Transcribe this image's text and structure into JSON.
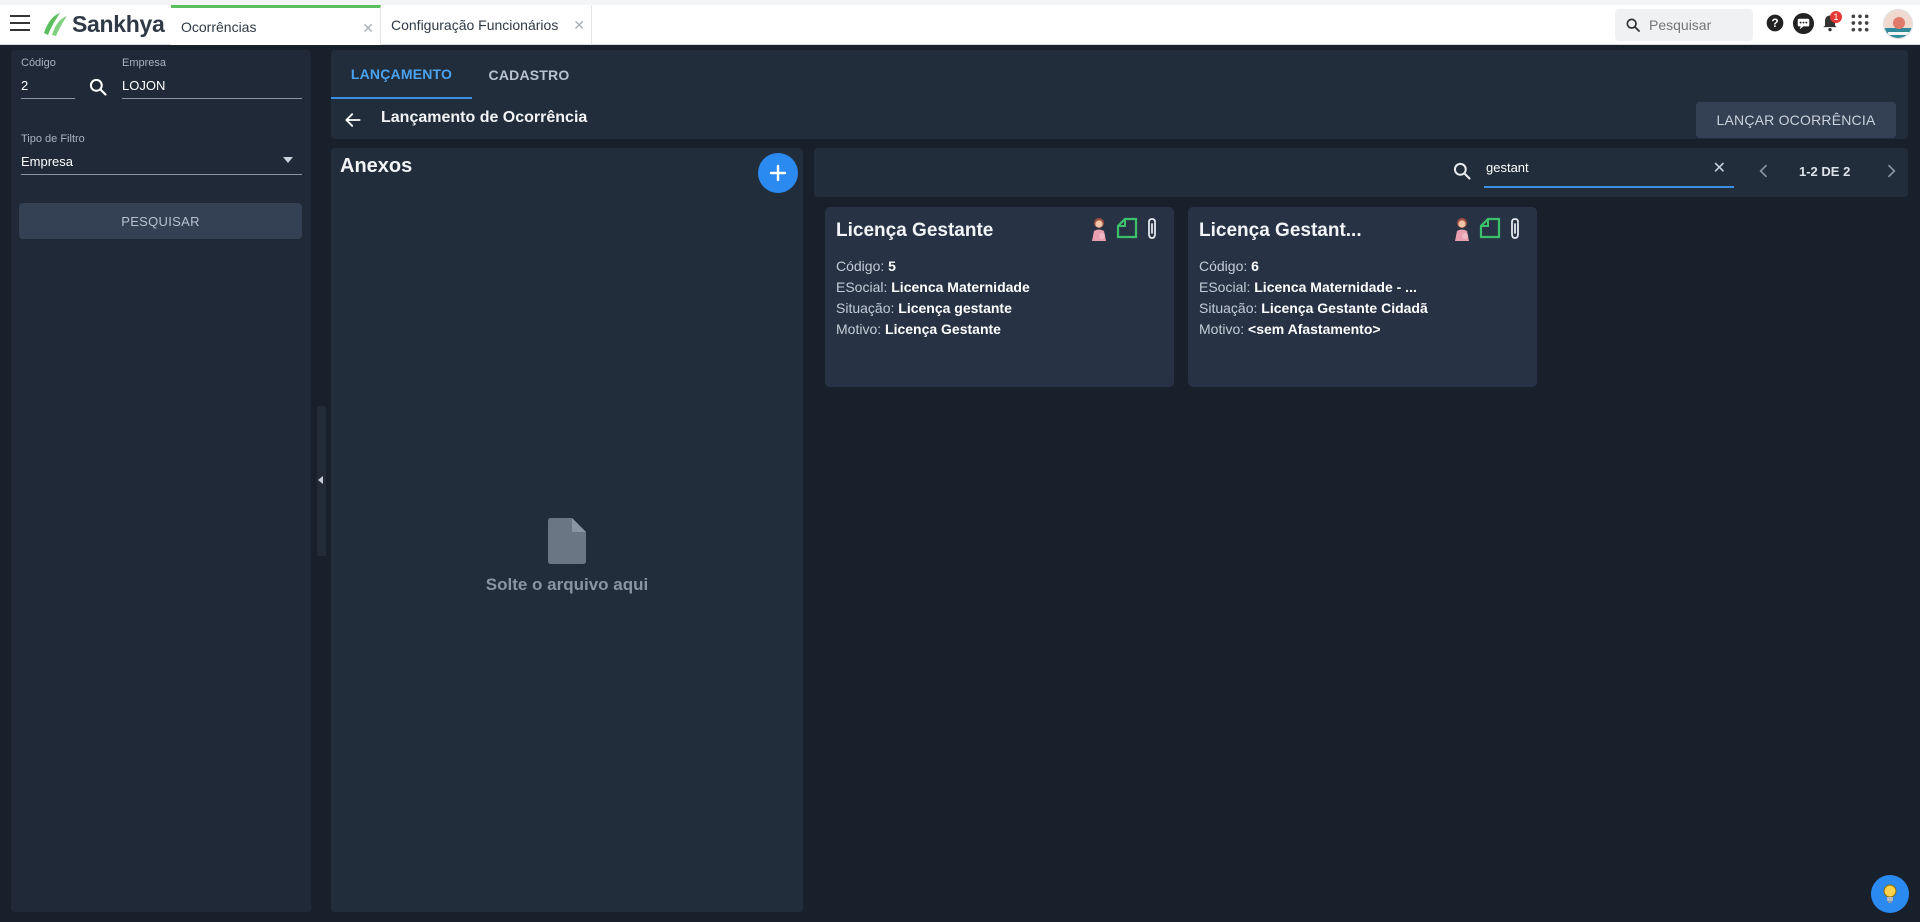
{
  "app": {
    "brand": "Sankhya",
    "tabs": [
      {
        "label": "Ocorrências"
      },
      {
        "label": "Configuração Funcionários"
      }
    ],
    "search_placeholder": "Pesquisar",
    "notification_count": "1"
  },
  "filters": {
    "codigo_label": "Código",
    "codigo_value": "2",
    "empresa_label": "Empresa",
    "empresa_value": "LOJON",
    "tipo_filtro_label": "Tipo de Filtro",
    "tipo_filtro_value": "Empresa",
    "search_button": "PESQUISAR"
  },
  "main": {
    "tabs": [
      {
        "label": "LANÇAMENTO",
        "active": true
      },
      {
        "label": "CADASTRO",
        "active": false
      }
    ],
    "page_title": "Lançamento de Ocorrência",
    "action_button": "LANÇAR OCORRÊNCIA"
  },
  "anexos": {
    "title": "Anexos",
    "drop_text": "Solte o arquivo aqui"
  },
  "results": {
    "search_value": "gestant",
    "pager": "1-2 DE 2",
    "cards": [
      {
        "title": "Licença Gestante",
        "codigo_label": "Código:",
        "codigo": "5",
        "esocial_label": "ESocial:",
        "esocial": "Licenca Maternidade",
        "situacao_label": "Situação:",
        "situacao": "Licença gestante",
        "motivo_label": "Motivo:",
        "motivo": "Licença Gestante"
      },
      {
        "title": "Licença Gestant...",
        "codigo_label": "Código:",
        "codigo": "6",
        "esocial_label": "ESocial:",
        "esocial": "Licenca Maternidade - ...",
        "situacao_label": "Situação:",
        "situacao": "Licença Gestante Cidadã",
        "motivo_label": "Motivo:",
        "motivo": "<sem Afastamento>"
      }
    ]
  },
  "colors": {
    "accent": "#2b8af0",
    "brand_green": "#5cbf5d",
    "panel": "#222d3b",
    "background": "#18202b"
  }
}
